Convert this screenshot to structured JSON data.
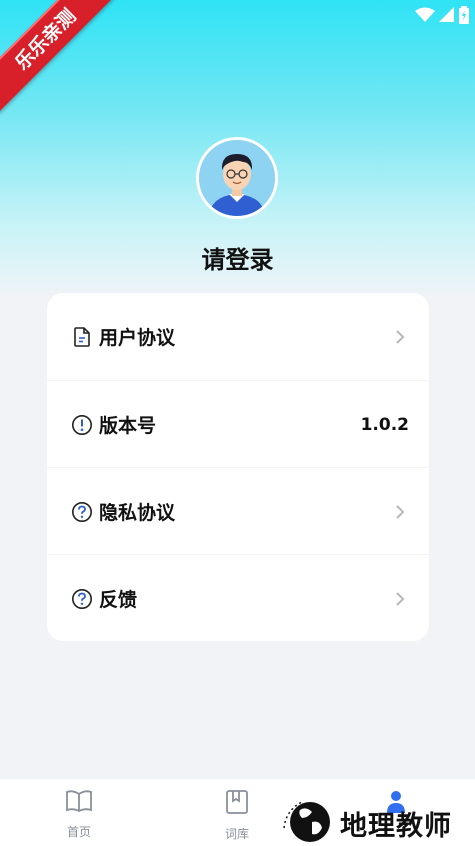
{
  "badge": {
    "text": "乐乐亲测"
  },
  "profile": {
    "login_label": "请登录"
  },
  "menu": {
    "items": [
      {
        "label": "用户协议",
        "value": "",
        "icon": "document-icon",
        "has_chevron": true
      },
      {
        "label": "版本号",
        "value": "1.0.2",
        "icon": "info-icon",
        "has_chevron": false
      },
      {
        "label": "隐私协议",
        "value": "",
        "icon": "question-icon",
        "has_chevron": true
      },
      {
        "label": "反馈",
        "value": "",
        "icon": "question-icon",
        "has_chevron": true
      }
    ]
  },
  "tabbar": {
    "tabs": [
      {
        "label": "首页",
        "icon": "book-open-icon"
      },
      {
        "label": "词库",
        "icon": "bookmark-book-icon"
      },
      {
        "label": "",
        "icon": "user-icon"
      }
    ]
  },
  "watermark": {
    "text": "地理教师"
  },
  "colors": {
    "accent_top": "#2fe3f5",
    "badge": "#d8202a",
    "background": "#f2f3f7"
  }
}
